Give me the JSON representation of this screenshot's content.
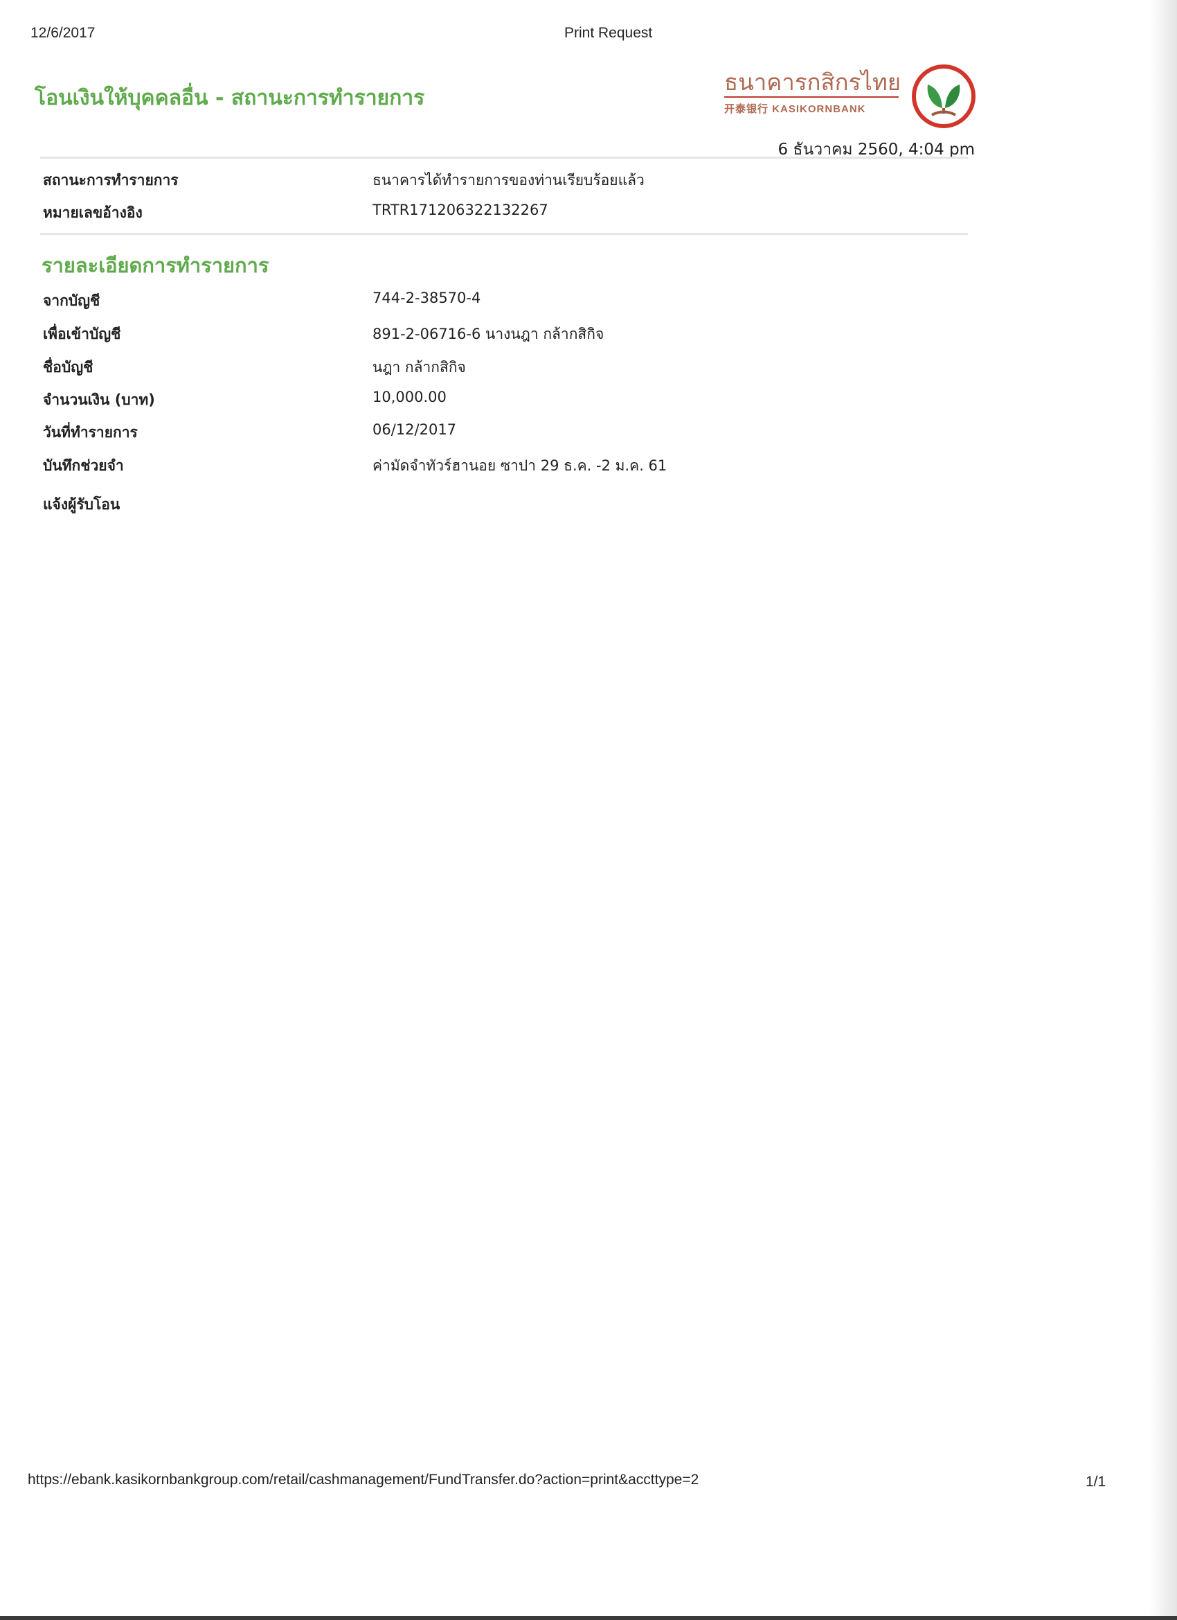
{
  "print_header": {
    "date": "12/6/2017",
    "title": "Print Request"
  },
  "page_title": "โอนเงินให้บุคคลอื่น - สถานะการทำรายการ",
  "logo": {
    "thai_name": "ธนาคารกสิกรไทย",
    "sub_name": "开泰银行 KASIKORNBANK",
    "brand_color": "#5faa4c",
    "accent_color": "#c0392b"
  },
  "timestamp": "6 ธันวาคม 2560, 4:04 pm",
  "status": [
    {
      "label": "สถานะการทำรายการ",
      "value": "ธนาคารได้ทำรายการของท่านเรียบร้อยแล้ว"
    },
    {
      "label": "หมายเลขอ้างอิง",
      "value": "TRTR171206322132267"
    }
  ],
  "details_title": "รายละเอียดการทำรายการ",
  "details": [
    {
      "label": "จากบัญชี",
      "value": "744-2-38570-4"
    },
    {
      "label": "เพื่อเข้าบัญชี",
      "value": "891-2-06716-6 นางนฎา กล้ากสิกิจ"
    },
    {
      "label": "ชื่อบัญชี",
      "value": "นฎา กล้ากสิกิจ"
    },
    {
      "label": "จำนวนเงิน (บาท)",
      "value": "10,000.00"
    },
    {
      "label": "วันที่ทำรายการ",
      "value": "06/12/2017"
    },
    {
      "label": "บันทึกช่วยจำ",
      "value": "ค่ามัดจำทัวร์ฮานอย ซาปา 29 ธ.ค. -2 ม.ค. 61"
    },
    {
      "label": "แจ้งผู้รับโอน",
      "value": ""
    }
  ],
  "footer": {
    "url": "https://ebank.kasikornbankgroup.com/retail/cashmanagement/FundTransfer.do?action=print&accttype=2",
    "page": "1/1"
  }
}
